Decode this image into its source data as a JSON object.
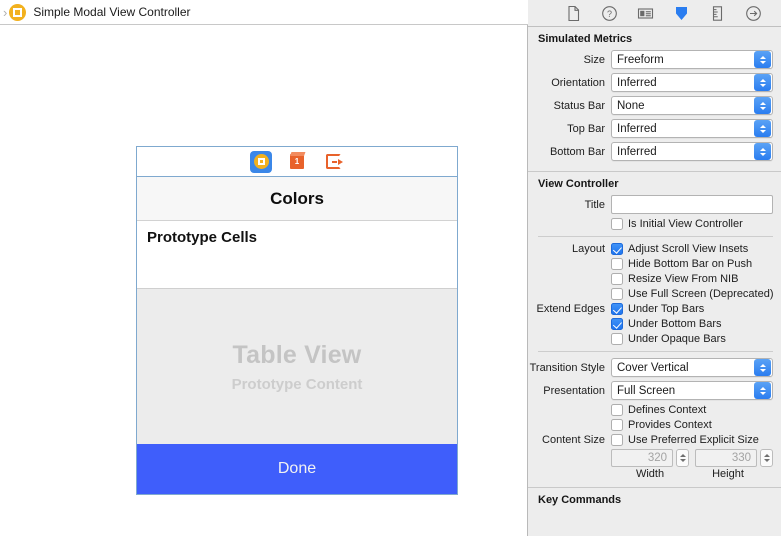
{
  "breadcrumb": {
    "chevron": "chevron-right-icon",
    "icon": "view-controller-icon",
    "title": "Simple Modal View Controller"
  },
  "canvas": {
    "dock": {
      "items": [
        {
          "name": "view-controller",
          "icon": "view-controller-icon",
          "selected": true
        },
        {
          "name": "first-responder",
          "icon": "first-responder-icon",
          "selected": false
        },
        {
          "name": "exit",
          "icon": "exit-icon",
          "selected": false
        }
      ]
    },
    "nav_title": "Colors",
    "prototype_cell_label": "Prototype Cells",
    "table_placeholder_title": "Table View",
    "table_placeholder_subtitle": "Prototype Content",
    "done_button_label": "Done",
    "done_button_color": "#3f5efb"
  },
  "inspector": {
    "toolbar": [
      {
        "name": "file-inspector-icon",
        "label": "File Inspector",
        "selected": false
      },
      {
        "name": "quick-help-icon",
        "label": "Quick Help",
        "selected": false
      },
      {
        "name": "identity-inspector-icon",
        "label": "Identity Inspector",
        "selected": false
      },
      {
        "name": "attributes-inspector-icon",
        "label": "Attributes Inspector",
        "selected": true
      },
      {
        "name": "size-inspector-icon",
        "label": "Size Inspector",
        "selected": false
      },
      {
        "name": "connections-inspector-icon",
        "label": "Connections Inspector",
        "selected": false
      }
    ],
    "accent_color": "#2a7df0",
    "simulated_metrics": {
      "title": "Simulated Metrics",
      "fields": [
        {
          "label": "Size",
          "value": "Freeform"
        },
        {
          "label": "Orientation",
          "value": "Inferred"
        },
        {
          "label": "Status Bar",
          "value": "None"
        },
        {
          "label": "Top Bar",
          "value": "Inferred"
        },
        {
          "label": "Bottom Bar",
          "value": "Inferred"
        }
      ]
    },
    "view_controller": {
      "title": "View Controller",
      "title_field": {
        "label": "Title",
        "value": "",
        "placeholder": ""
      },
      "is_initial": {
        "label": "Is Initial View Controller",
        "checked": false
      },
      "layout": {
        "label": "Layout",
        "options": [
          {
            "label": "Adjust Scroll View Insets",
            "checked": true
          },
          {
            "label": "Hide Bottom Bar on Push",
            "checked": false
          },
          {
            "label": "Resize View From NIB",
            "checked": false
          },
          {
            "label": "Use Full Screen (Deprecated)",
            "checked": false
          }
        ]
      },
      "extend_edges": {
        "label": "Extend Edges",
        "options": [
          {
            "label": "Under Top Bars",
            "checked": true
          },
          {
            "label": "Under Bottom Bars",
            "checked": true
          },
          {
            "label": "Under Opaque Bars",
            "checked": false
          }
        ]
      },
      "transition_style": {
        "label": "Transition Style",
        "value": "Cover Vertical"
      },
      "presentation": {
        "label": "Presentation",
        "value": "Full Screen"
      },
      "defines_context": {
        "label": "Defines Context",
        "checked": false
      },
      "provides_context": {
        "label": "Provides Context",
        "checked": false
      },
      "content_size": {
        "label": "Content Size",
        "use_preferred": {
          "label": "Use Preferred Explicit Size",
          "checked": false
        },
        "width": {
          "value": "320",
          "sublabel": "Width"
        },
        "height": {
          "value": "330",
          "sublabel": "Height"
        }
      }
    },
    "key_commands": {
      "title": "Key Commands"
    }
  }
}
